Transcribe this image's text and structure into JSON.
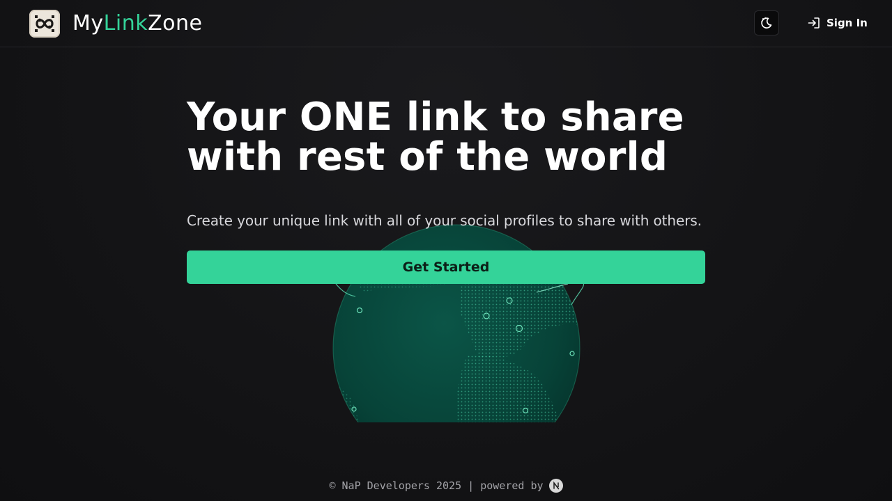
{
  "header": {
    "brand_parts": [
      "My",
      "Link",
      "Zone"
    ],
    "theme_toggle_icon": "moon-stars-icon",
    "signin_icon": "login-arrow-icon",
    "signin_label": "Sign In"
  },
  "hero": {
    "title_line1": "Your ONE link to share",
    "title_line2": "with rest of the world",
    "subtitle": "Create your unique link with all of your social profiles to share with others.",
    "cta_label": "Get Started",
    "illustration": "globe-icon"
  },
  "footer": {
    "text": "© NaP Developers 2025 | powered by",
    "badge_icon": "nextjs-icon"
  },
  "colors": {
    "background": "#141416",
    "accent": "#34d399",
    "text": "#ffffff",
    "muted": "#a3a3a8"
  }
}
